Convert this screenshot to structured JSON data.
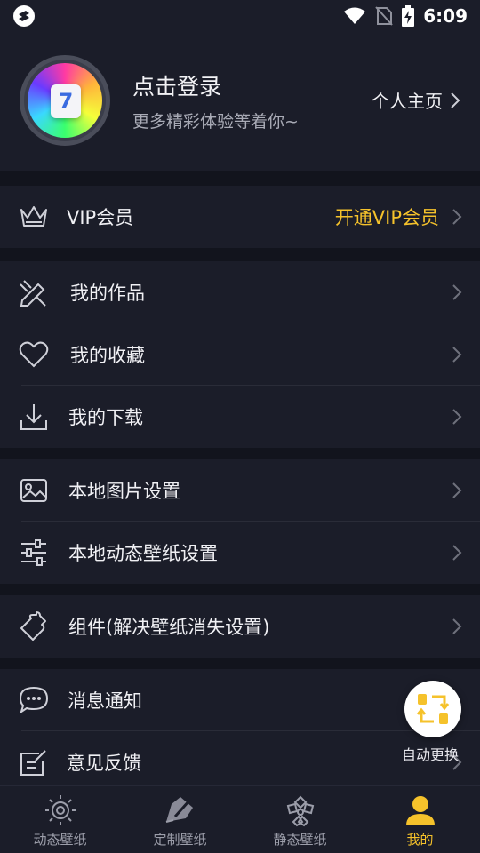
{
  "status_bar": {
    "time": "6:09",
    "icons": [
      "app-notification-icon",
      "wifi-icon",
      "no-sim-icon",
      "battery-charging-icon"
    ]
  },
  "profile": {
    "login_title": "点击登录",
    "login_subtitle": "更多精彩体验等着你~",
    "homepage_label": "个人主页",
    "avatar_glyph": "7"
  },
  "vip": {
    "label": "VIP会员",
    "action": "开通VIP会员",
    "accent": "#f5c22b"
  },
  "menu": {
    "works": "我的作品",
    "favorites": "我的收藏",
    "downloads": "我的下载",
    "local_image": "本地图片设置",
    "local_live": "本地动态壁纸设置",
    "widget": "组件(解决壁纸消失设置)",
    "notifications": "消息通知",
    "feedback": "意见反馈"
  },
  "fab": {
    "label": "自动更换"
  },
  "tabs": [
    {
      "label": "动态壁纸",
      "icon": "sun-gear-icon"
    },
    {
      "label": "定制壁纸",
      "icon": "brush-icon"
    },
    {
      "label": "静态壁纸",
      "icon": "flower-icon"
    },
    {
      "label": "我的",
      "icon": "person-icon"
    }
  ]
}
